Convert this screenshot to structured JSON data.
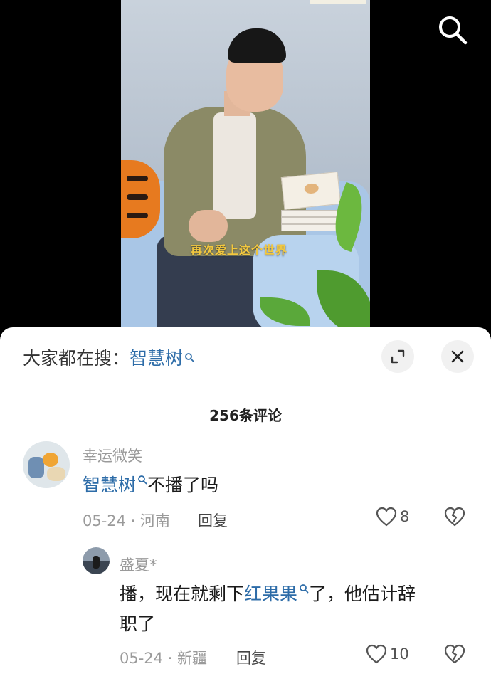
{
  "video": {
    "caption": "再次爱上这个世界"
  },
  "sheet": {
    "suggest_prefix": "大家都在搜：",
    "suggest_keyword": "智慧树",
    "count_label": "256条评论",
    "comments": [
      {
        "username": "幸运微笑",
        "keyword": "智慧树",
        "text": "不播了吗",
        "meta": "05-24 · 河南",
        "reply_label": "回复",
        "likes": "8"
      },
      {
        "username": "盛夏*",
        "text_before": "播，现在就剩下",
        "keyword": "红果果",
        "text_after": "了，他估计辞",
        "text_line2": "职了",
        "meta": "05-24 · 新疆",
        "reply_label": "回复",
        "likes": "10"
      }
    ]
  },
  "colors": {
    "keyword": "#2d6ca8",
    "caption": "#f3c83f"
  },
  "icons": [
    "search-icon",
    "expand-icon",
    "close-icon",
    "heart-icon",
    "broken-heart-icon"
  ]
}
